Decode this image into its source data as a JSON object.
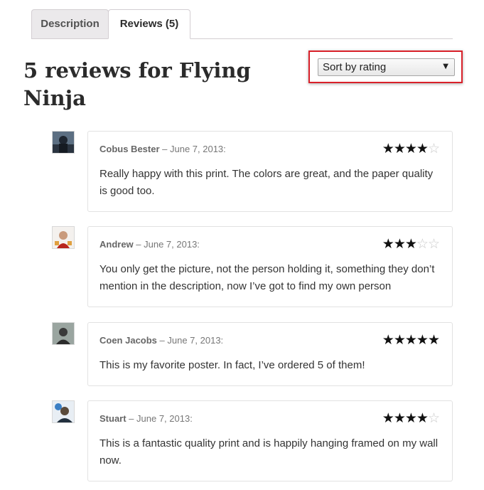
{
  "tabs": {
    "description_label": "Description",
    "reviews_label": "Reviews (5)"
  },
  "heading": "5 reviews for Flying Ninja",
  "sort": {
    "selected": "Sort by rating",
    "arrow": "▼"
  },
  "reviews": [
    {
      "author": "Cobus Bester",
      "date": " – June 7, 2013:",
      "rating": 4,
      "text": "Really happy with this print. The colors are great, and the paper quality is good too."
    },
    {
      "author": "Andrew",
      "date": " – June 7, 2013:",
      "rating": 3,
      "text": "You only get the picture, not the person holding it, something they don’t mention in the description, now I’ve got to find my own person"
    },
    {
      "author": "Coen Jacobs",
      "date": " – June 7, 2013:",
      "rating": 5,
      "text": "This is my favorite poster. In fact, I’ve ordered 5 of them!"
    },
    {
      "author": "Stuart",
      "date": " – June 7, 2013:",
      "rating": 4,
      "text": "This is a fantastic quality print and is happily hanging framed on my wall now."
    }
  ],
  "colors": {
    "highlight": "#d9212a",
    "star_filled": "#111111",
    "star_empty": "#c9c9c9"
  },
  "icons": {
    "star_filled": "star-icon",
    "star_empty": "star-outline-icon",
    "dropdown": "chevron-down-icon"
  }
}
